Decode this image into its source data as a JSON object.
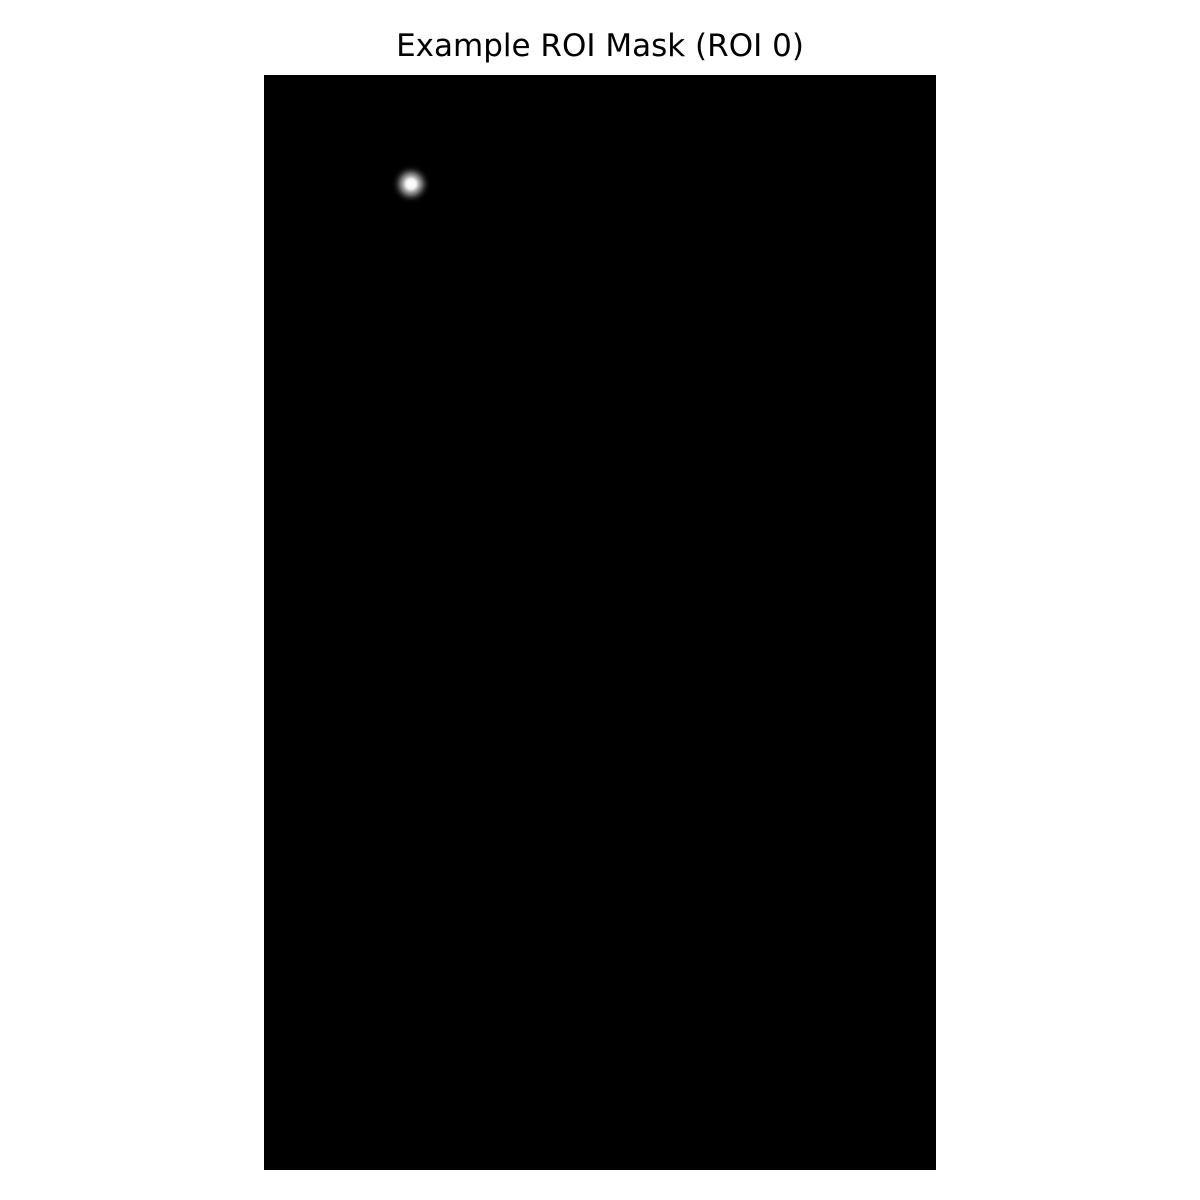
{
  "figure": {
    "title": "Example ROI Mask (ROI 0)"
  },
  "image": {
    "background_color": "#000000",
    "colormap": "gray",
    "roi_index": 0,
    "roi_color": "#ffffff"
  }
}
